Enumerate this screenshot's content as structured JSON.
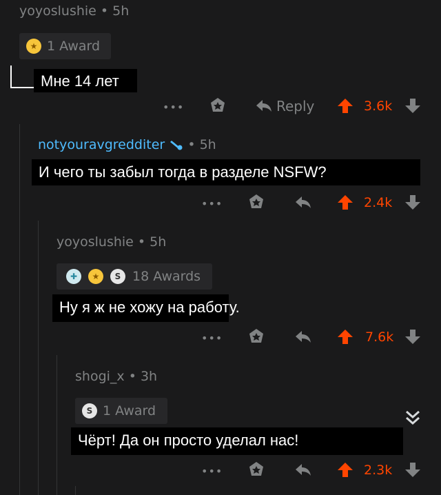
{
  "colors": {
    "background": "#1a1a1b",
    "meta_text": "#818384",
    "upvote": "#ff4500",
    "mod_username": "#4fbcff"
  },
  "comments": [
    {
      "username": "yoyoslushie",
      "time": "• 5h",
      "awards_label": "1 Award",
      "award_icons": [
        "gold-award-icon"
      ],
      "text": "Мне 14 лет",
      "reply_label": "Reply",
      "votes": "3.6k"
    },
    {
      "username": "notyouravgredditer",
      "user_flair_icon": "wrench-icon",
      "time": "• 5h",
      "text": "И чего ты забыл тогда в разделе NSFW?",
      "votes": "2.4k"
    },
    {
      "username": "yoyoslushie",
      "time": "• 5h",
      "awards_label": "18 Awards",
      "award_icons": [
        "helpful-award-icon",
        "gold-award-icon",
        "silver-award-icon"
      ],
      "text": "Ну я ж не хожу на работу.",
      "votes": "7.6k"
    },
    {
      "username": "shogi_x",
      "time": "• 3h",
      "awards_label": "1 Award",
      "award_icons": [
        "silver-award-icon"
      ],
      "text": "Чёрт! Да он просто уделал нас!",
      "votes": "2.3k"
    }
  ],
  "more_dots": "•••"
}
